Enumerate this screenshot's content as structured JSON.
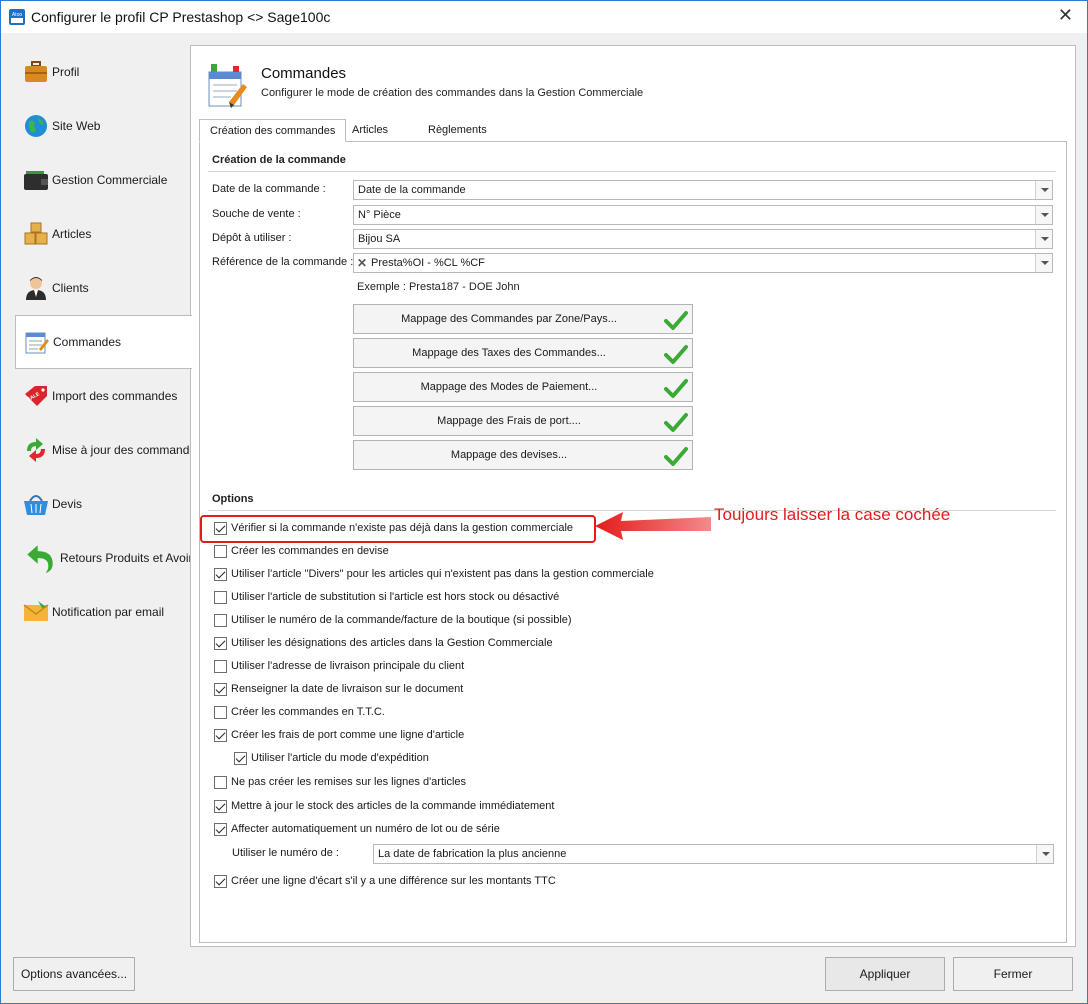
{
  "window": {
    "title": "Configurer le profil CP Prestashop <> Sage100c",
    "close_glyph": "✕"
  },
  "sidebar": {
    "items": [
      {
        "label": "Profil",
        "icon": "briefcase-icon"
      },
      {
        "label": "Site Web",
        "icon": "globe-icon"
      },
      {
        "label": "Gestion Commerciale",
        "icon": "wallet-icon"
      },
      {
        "label": "Articles",
        "icon": "boxes-icon"
      },
      {
        "label": "Clients",
        "icon": "person-icon"
      },
      {
        "label": "Commandes",
        "icon": "order-sheet-icon",
        "active": true
      },
      {
        "label": "Import des commandes",
        "icon": "sale-tag-icon",
        "tag": "SALE"
      },
      {
        "label": "Mise à jour des commandes",
        "icon": "refresh-arrows-icon"
      },
      {
        "label": "Devis",
        "icon": "basket-icon"
      },
      {
        "label": "Retours Produits et Avoirs",
        "icon": "return-arrow-icon"
      },
      {
        "label": "Notification par email",
        "icon": "envelope-icon"
      }
    ]
  },
  "header": {
    "title": "Commandes",
    "subtitle": "Configurer le mode de création des commandes dans la Gestion Commerciale"
  },
  "tabs": [
    {
      "label": "Création des commandes",
      "active": true
    },
    {
      "label": "Articles"
    },
    {
      "label": "Règlements"
    }
  ],
  "creation": {
    "group_title": "Création de la commande",
    "fields": [
      {
        "label": "Date de la commande :",
        "value": "Date de la commande"
      },
      {
        "label": "Souche de vente :",
        "value": "N° Pièce"
      },
      {
        "label": "Dépôt à utiliser :",
        "value": "Bijou SA"
      },
      {
        "label": "Référence de la commande :",
        "value": "Presta%OI - %CL %CF",
        "clear_glyph": "✕"
      }
    ],
    "example": "Exemple : Presta187 - DOE John",
    "mapping_buttons": [
      {
        "label": "Mappage des Commandes par Zone/Pays..."
      },
      {
        "label": "Mappage des Taxes des Commandes..."
      },
      {
        "label": "Mappage des Modes de Paiement..."
      },
      {
        "label": "Mappage des Frais de port...."
      },
      {
        "label": "Mappage des devises..."
      }
    ]
  },
  "options": {
    "group_title": "Options",
    "items": [
      {
        "label": "Vérifier si la commande n'existe pas déjà dans la gestion commerciale",
        "checked": true
      },
      {
        "label": "Créer les commandes en devise",
        "checked": false
      },
      {
        "label": "Utiliser l'article \"Divers\" pour les articles qui n'existent pas dans la gestion commerciale",
        "checked": true
      },
      {
        "label": "Utiliser l'article de substitution si l'article est hors stock ou désactivé",
        "checked": false
      },
      {
        "label": "Utiliser le numéro de la commande/facture de la boutique (si possible)",
        "checked": false
      },
      {
        "label": "Utiliser les désignations des articles dans la Gestion Commerciale",
        "checked": true
      },
      {
        "label": "Utiliser l'adresse de livraison principale du client",
        "checked": false
      },
      {
        "label": "Renseigner la date de livraison sur le document",
        "checked": true
      },
      {
        "label": "Créer les commandes en T.T.C.",
        "checked": false
      },
      {
        "label": "Créer les frais de port comme une ligne d'article",
        "checked": true
      },
      {
        "label": "Utiliser l'article du mode d'expédition",
        "checked": true,
        "indent": true
      },
      {
        "label": "Ne pas créer les remises sur les lignes d'articles",
        "checked": false
      },
      {
        "label": "Mettre à jour le stock des articles de la commande immédiatement",
        "checked": true
      },
      {
        "label": "Affecter automatiquement un numéro de lot ou de série",
        "checked": true
      }
    ],
    "lot_field": {
      "label": "Utiliser le numéro de :",
      "value": "La date de fabrication la plus ancienne"
    },
    "last_item": {
      "label": "Créer une ligne d'écart s'il y a une différence sur les montants TTC",
      "checked": true
    }
  },
  "annotation": {
    "text": "Toujours laisser la case cochée",
    "color": "#e41b1b"
  },
  "footer": {
    "advanced_label": "Options avancées...",
    "apply_label": "Appliquer",
    "close_label": "Fermer"
  },
  "colors": {
    "accent_border": "#2b7bd4",
    "check_green": "#3aaa35",
    "annotation_red": "#e41b1b"
  }
}
